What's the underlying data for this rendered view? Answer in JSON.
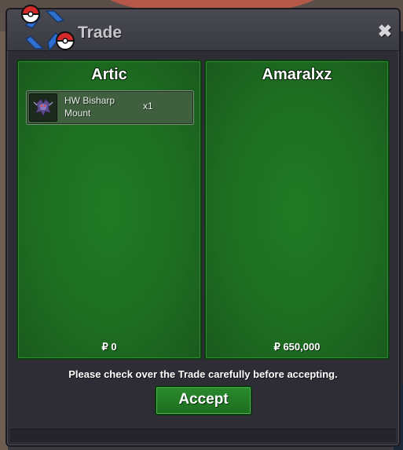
{
  "window": {
    "title": "Trade",
    "close_label": "✖"
  },
  "left_panel": {
    "player_name": "Artic",
    "money": "₽ 0",
    "items": [
      {
        "name_line1": "HW Bisharp",
        "name_line2": "Mount",
        "quantity": "x1",
        "icon": "bisharp-mount-icon"
      }
    ]
  },
  "right_panel": {
    "player_name": "Amaralxz",
    "money": "₽ 650,000",
    "items": []
  },
  "notice": "Please check over the Trade carefully before accepting.",
  "accept_button": "Accept",
  "colors": {
    "panel_green": "#1f7a24",
    "window_bg": "#2e2d35",
    "button_green": "#2a8a2c"
  }
}
